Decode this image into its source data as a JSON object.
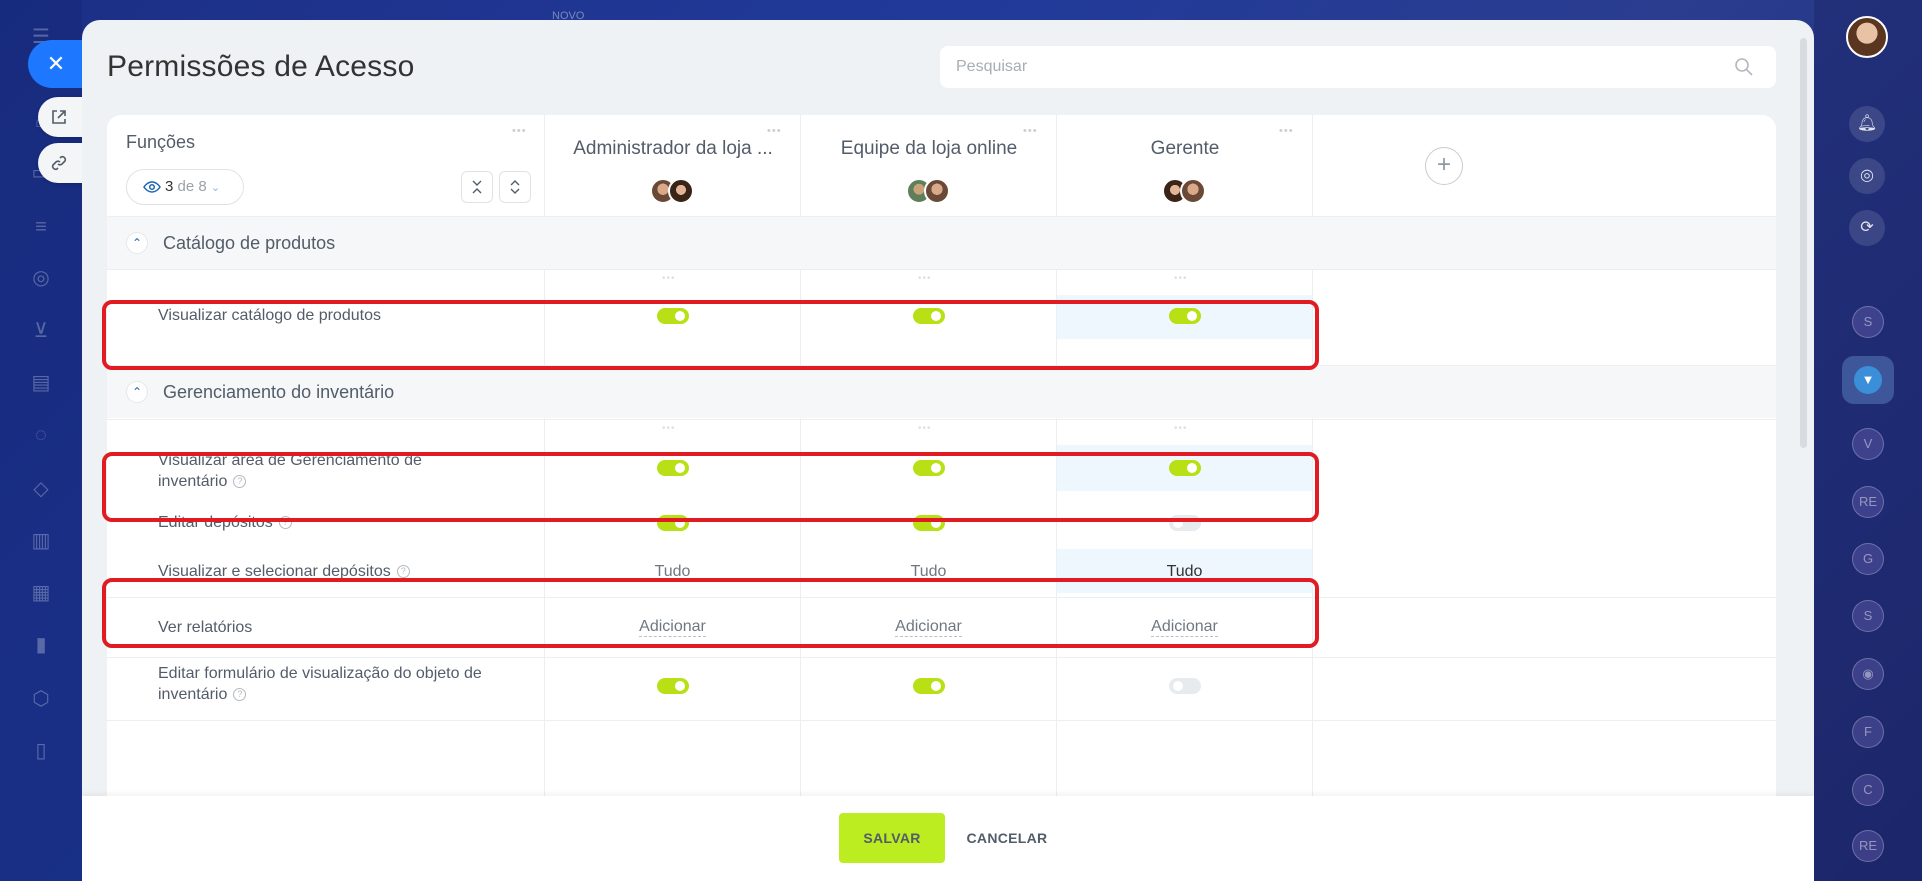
{
  "page": {
    "title": "Permissões de Acesso",
    "search_placeholder": "Pesquisar"
  },
  "header": {
    "functions_label": "Funções",
    "filter": {
      "count": "3",
      "of_label": "de 8"
    },
    "roles": [
      {
        "name": "Administrador da loja ..."
      },
      {
        "name": "Equipe da loja online"
      },
      {
        "name": "Gerente"
      }
    ]
  },
  "sections": [
    {
      "title": "Catálogo de produtos",
      "rows": [
        {
          "label": "Visualizar catálogo de produtos",
          "values": [
            true,
            true,
            true
          ],
          "highlighted": true
        }
      ]
    },
    {
      "title": "Gerenciamento do inventário",
      "rows": [
        {
          "label": "Visualizar área de Gerenciamento de inventário",
          "values": [
            true,
            true,
            true
          ],
          "highlighted": true,
          "help": true
        },
        {
          "label": "Editar depósitos",
          "values": [
            true,
            true,
            false
          ],
          "help": true
        },
        {
          "label": "Visualizar e selecionar depósitos",
          "values": [
            "Tudo",
            "Tudo",
            "Tudo"
          ],
          "highlighted": true,
          "help": true
        },
        {
          "label": "Ver relatórios",
          "values": [
            "Adicionar",
            "Adicionar",
            "Adicionar"
          ]
        },
        {
          "label": "Editar formulário de visualização do objeto de inventário",
          "values": [
            true,
            true,
            false
          ],
          "help": true
        }
      ]
    }
  ],
  "footer": {
    "save_label": "SALVAR",
    "cancel_label": "CANCELAR"
  },
  "colors": {
    "toggle_on": "#b8e014",
    "highlight_border": "#e01b22",
    "save_button": "#bbed21",
    "close_button": "#1e78ff"
  },
  "right_bar": {
    "items": [
      "S",
      "V",
      "RE",
      "G",
      "S",
      "F",
      "C",
      "RE"
    ]
  },
  "background_peek": "NOVO"
}
